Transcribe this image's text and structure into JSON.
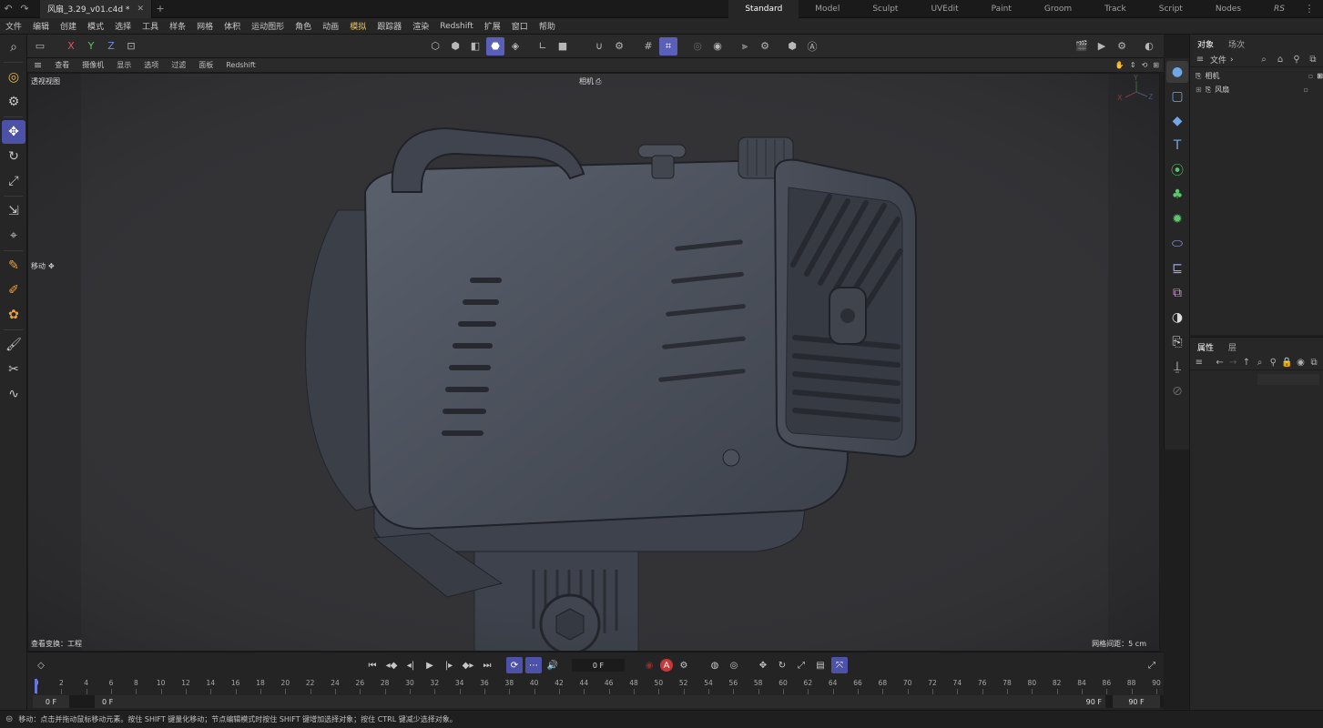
{
  "titlebar": {
    "doc_tab": "风扇_3.29_v01.c4d *",
    "layouts": [
      "Standard",
      "Model",
      "Sculpt",
      "UVEdit",
      "Paint",
      "Groom",
      "Track",
      "Script",
      "Nodes",
      "RS"
    ],
    "active_layout": "Standard"
  },
  "menu": [
    "文件",
    "编辑",
    "创建",
    "模式",
    "选择",
    "工具",
    "样条",
    "网格",
    "体积",
    "运动图形",
    "角色",
    "动画",
    "模拟",
    "跟踪器",
    "渲染",
    "Redshift",
    "扩展",
    "窗口",
    "帮助"
  ],
  "toolbar": {
    "axes": [
      "X",
      "Y",
      "Z"
    ]
  },
  "viewport": {
    "menu": [
      "查看",
      "摄像机",
      "显示",
      "选项",
      "过滤",
      "面板",
      "Redshift"
    ],
    "name": "透视视图",
    "camera_label": "相机",
    "tool_label": "移动",
    "transform_label": "查看变换：工程",
    "grid_label": "网格间距：5 cm",
    "axis_y": "Y",
    "axis_x": "X",
    "axis_z": "Z"
  },
  "object_panel": {
    "tabs": [
      "对象",
      "场次"
    ],
    "file_menu": "文件",
    "objects": [
      {
        "name": "相机"
      },
      {
        "name": "风扇"
      }
    ]
  },
  "attr_panel": {
    "tabs": [
      "属性",
      "层"
    ]
  },
  "timeline": {
    "current_frame": "0 F",
    "ticks": [
      0,
      2,
      4,
      6,
      8,
      10,
      12,
      14,
      16,
      18,
      20,
      22,
      24,
      26,
      28,
      30,
      32,
      34,
      36,
      38,
      40,
      42,
      44,
      46,
      48,
      50,
      52,
      54,
      56,
      58,
      60,
      62,
      64,
      66,
      68,
      70,
      72,
      74,
      76,
      78,
      80,
      82,
      84,
      86,
      88,
      90
    ],
    "range_start_a": "0 F",
    "range_start_b": "0 F",
    "range_end_a": "90 F",
    "range_end_b": "90 F",
    "record_label": "A"
  },
  "status": {
    "text": "移动：点击并拖动鼠标移动元素。按住 SHIFT 键量化移动；节点编辑模式时按住 SHIFT 键增加选择对象；按住 CTRL 键减少选择对象。"
  },
  "colors": {
    "accent": "#5a5fb8",
    "viewport_bg": "#333336",
    "model": "#4a505c"
  }
}
